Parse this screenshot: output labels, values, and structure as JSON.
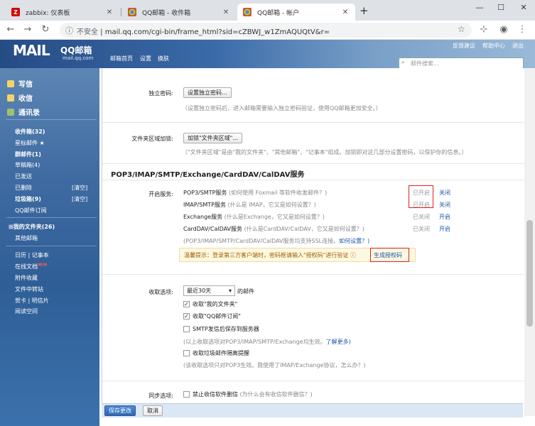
{
  "browser": {
    "tabs": [
      {
        "title": "zabbix: 仪表板",
        "fav": "Z",
        "fav_color": "#d40000"
      },
      {
        "title": "QQ邮箱 - 收件箱",
        "fav": "",
        "fav_color": "#4285f4"
      },
      {
        "title": "QQ邮箱 - 帐户",
        "fav": "",
        "fav_color": "#4285f4"
      }
    ],
    "new_tab": "+",
    "not_secure": "不安全",
    "url": "mail.qq.com/cgi-bin/frame_html?sid=cZBWJ_w1ZmAQUQtV&r="
  },
  "header": {
    "logo": "MAIL",
    "brand": "QQ邮箱",
    "domain": "mail.qq.com",
    "nav": [
      "邮箱首页",
      "设置",
      "换肤"
    ],
    "top_links": [
      "反馈建议",
      "帮助中心",
      "退出"
    ],
    "search_placeholder": "邮件搜索..."
  },
  "sidebar": {
    "write": "写信",
    "receive": "收信",
    "contacts": "通讯录",
    "folders": [
      {
        "label": "收件箱(32)"
      },
      {
        "label": "星标邮件 ★"
      },
      {
        "label": "群邮件(1)"
      },
      {
        "label": "草稿箱(4)"
      },
      {
        "label": "已发送"
      },
      {
        "label": "已删除",
        "action": "[清空]"
      },
      {
        "label": "垃圾箱(9)",
        "action": "[清空]"
      },
      {
        "label": "QQ邮件订阅"
      }
    ],
    "my_folders": "⊞我的文件夹(26)",
    "other_mail": "其他邮箱",
    "apps": [
      "日历 | 记事本",
      "在线文档",
      "附件收藏",
      "文件中转站",
      "贺卡 | 明信片",
      "阅读空间"
    ],
    "new_badge": "NEW"
  },
  "settings": {
    "standalone_pwd_label": "独立密码:",
    "standalone_pwd_btn": "设置独立密码...",
    "standalone_pwd_desc": "（设置独立密码后，进入邮箱需要输入独立密码验证，使用QQ邮箱更加安全。）",
    "folder_encrypt_label": "文件夹区域加锁:",
    "folder_encrypt_btn": "加锁\"文件夹区域\"...",
    "folder_encrypt_desc": "（\"文件夹区域\"是由\"我的文件夹\"、\"其他邮箱\"、\"记事本\"组成。加锁即对这几部分设置密码，以保护你的信息。）",
    "section_title": "POP3/IMAP/SMTP/Exchange/CardDAV/CalDAV服务",
    "service_label": "开启服务:",
    "services": [
      {
        "name": "POP3/SMTP服务",
        "hint": "(如何使用 Foxmail 等软件收发邮件？)",
        "status": "已开启",
        "action": "关闭"
      },
      {
        "name": "IMAP/SMTP服务",
        "hint": "(什么是 IMAP，它又是如何设置？)",
        "status": "已开启",
        "action": "关闭"
      },
      {
        "name": "Exchange服务",
        "hint": "(什么是Exchange，它又是如何设置？)",
        "status": "已关闭",
        "action": "开启"
      },
      {
        "name": "CardDAV/CalDAV服务",
        "hint": "(什么是CardDAV/CalDAV，它又是如何设置？)",
        "status": "已关闭",
        "action": "开启"
      }
    ],
    "ssl_note": "(POP3/IMAP/SMTP/CardDAV/CalDAV服务均支持SSL连接。",
    "ssl_link": "如何设置？)",
    "tip": "温馨提示：登录第三方客户端时，密码框请输入\"授权码\"进行验证",
    "tip_link": "生成授权码",
    "recv_label": "收取选项:",
    "recv_select": "最近30天",
    "recv_suffix": "的邮件",
    "recv_options": [
      {
        "label": "收取\"我的文件夹\"",
        "checked": true
      },
      {
        "label": "收取\"QQ邮件订阅\"",
        "checked": true
      },
      {
        "label": "SMTP发信后保存到服务器",
        "checked": false
      }
    ],
    "recv_note": "(以上收取选项对POP3/IMAP/SMTP/Exchange均生效。",
    "recv_note_link": "了解更多)",
    "junk_option": "收取垃圾邮件隔离提醒",
    "junk_note": "(该收取选项只对POP3生效。我使用了IMAP/Exchange协议，怎么办？)",
    "sync_label": "同步选项:",
    "sync_option": "禁止收信软件删信",
    "sync_hint": "(为什么会有收信软件删信？)"
  },
  "footer": {
    "save": "保存更改",
    "cancel": "取消"
  }
}
